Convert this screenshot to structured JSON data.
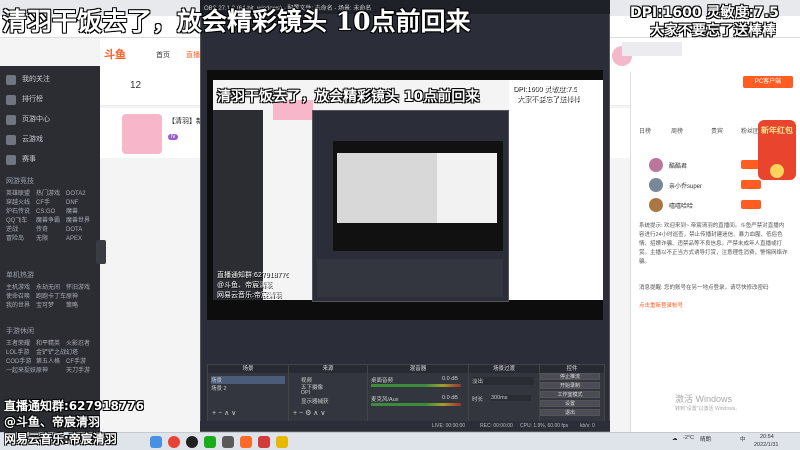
{
  "overlay": {
    "headline": "清羽干饭去了，放会精彩镜头 10点前回来",
    "dpi_line": "DPI:1600 灵敏度:7.5",
    "reminder": "大家不要忘了送棒棒",
    "fan_group": "直播通知群:627918776",
    "douyu_id": "@斗鱼、帝宸清羽",
    "music": "网易云音乐:帝宸清羽"
  },
  "browser": {
    "site_nav": [
      "首页",
      "直播"
    ],
    "brand": "斗鱼",
    "pc_client": "PC客户端",
    "follow_count": "12"
  },
  "sidebar": {
    "items": [
      "我的关注",
      "排行榜",
      "页游中心",
      "云游戏",
      "赛事"
    ],
    "section_hot": "网游竞技",
    "hot_games": [
      "英雄联盟",
      "热门游戏",
      "DOTA2",
      "穿越火线",
      "CF手",
      "DNF",
      "炉石传说",
      "CS:GO",
      "魔兽",
      "QQ飞车",
      "魔兽争霸",
      "魔兽世界",
      "逆战",
      "传奇",
      "DOTA",
      "冒险岛",
      "无限",
      "APEX"
    ],
    "section_mobile": "单机热游",
    "mobile_games": [
      "主机游戏",
      "永劫无间",
      "怀旧游戏",
      "使命召唤",
      "跑跑卡丁车",
      "原神",
      "我的世界",
      "宝可梦",
      "策略"
    ],
    "section_hand": "手游休闲",
    "hand_games": [
      "王者荣耀",
      "和平精英",
      "火影忍者",
      "LOL手游",
      "金铲铲之战",
      "幻塔",
      "COD手游",
      "第五人格",
      "CF手游",
      "一起来捉妖",
      "原神",
      "天刀手游"
    ]
  },
  "stream": {
    "title": "【清羽】新年快乐",
    "badge": "lv",
    "host_tag": "帝宸清羽"
  },
  "rightpanel": {
    "tabs": [
      "日榜",
      "周榜",
      "贵宾",
      "粉丝团"
    ],
    "ranks": [
      {
        "name": "酷酷君",
        "score": "1"
      },
      {
        "name": "亲小乔super",
        "score": "2"
      },
      {
        "name": "嘻嘻哈哈",
        "score": "3"
      }
    ],
    "system_msg": "系统提示: 欢迎来到~ 帝宸清羽的直播间。斗鱼严禁对直播内容进行24小时巡查，禁止传播封建迷信、暴力血腥、低俗色情、招嫖诈骗、违禁品等不良信息。严禁未成年人直播或打赏。主播以不正当方式诱导打赏，注意理性消费，警惕网络诈骗。",
    "anti_fraud": "消息提醒: 您的账号在另一地点登录，请尽快修改密码",
    "login_link": "点击重新登录帐号",
    "new_year_badge": "新年红包",
    "activate_windows": "激活 Windows",
    "activate_hint": "转到\"设置\"以激活 Windows。"
  },
  "obs": {
    "title": "OBS 27.1.3 (64-bit, windows) - 配置文件: 未命名 - 场景: 未命名",
    "menu": "文件(F)",
    "docks": {
      "scenes": {
        "title": "场景",
        "items": [
          "场景",
          "场景 2"
        ]
      },
      "sources": {
        "title": "来源",
        "items": [
          "视频",
          "五下摄像",
          "DPI",
          "显示器捕获"
        ]
      },
      "mixer": {
        "title": "混音器",
        "items": [
          "桌面音频",
          "麦克风/Aux"
        ],
        "levels": [
          "0.0 dB",
          "0.0 dB"
        ]
      },
      "transitions": {
        "title": "场景过渡",
        "type": "淡出",
        "duration_label": "时长",
        "duration": "300ms"
      },
      "controls": {
        "title": "控件",
        "buttons": [
          "停止推流",
          "开始录制",
          "工作室模式",
          "设置",
          "退出"
        ]
      }
    },
    "status": {
      "live": "LIVE: 00:00:00",
      "rec": "REC: 00:00:00",
      "cpu": "CPU: 1.9%, 60.00 fps",
      "kbps": "kb/s: 0"
    }
  },
  "taskbar": {
    "time": "20:54",
    "date": "2022/1/31",
    "temp": "-2°C",
    "weather": "晴朗",
    "lang": "中"
  },
  "colors": {
    "accent": "#ff5d23",
    "obs_bg": "#2b2e38",
    "sidebar_bg": "#2b2d33"
  }
}
